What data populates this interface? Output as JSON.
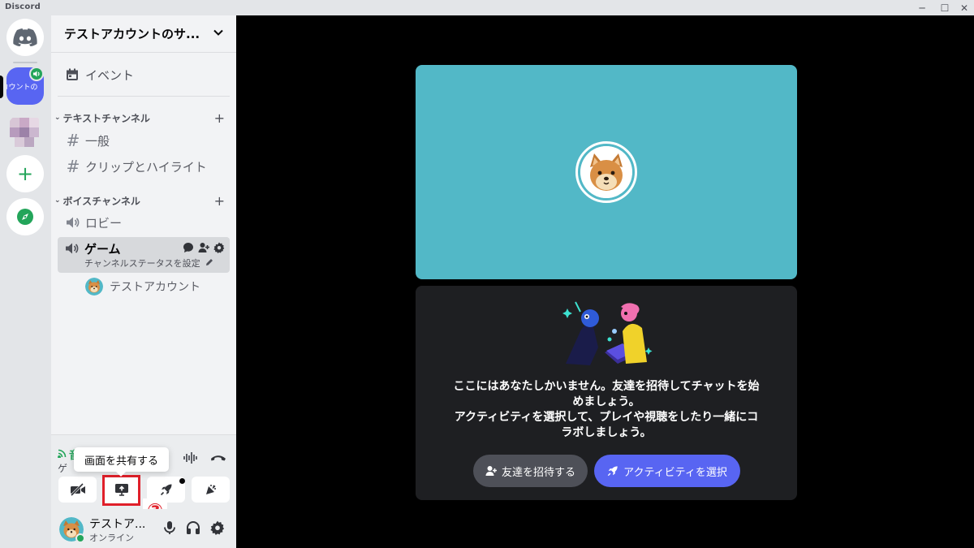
{
  "window": {
    "title": "Discord",
    "controls": {
      "minimize": "─",
      "maximize": "☐",
      "close": "✕"
    }
  },
  "rail": {
    "active_server_label": "カウントの",
    "add_glyph": "+"
  },
  "sidebar": {
    "server_name": "テストアカウントのサ...",
    "events_label": "イベント",
    "text_category": "テキストチャンネル",
    "text_channels": [
      "一般",
      "クリップとハイライト"
    ],
    "voice_category": "ボイスチャンネル",
    "voice_channels": [
      "ロビー"
    ],
    "active_voice_channel": {
      "name": "ゲーム",
      "status_prompt": "チャンネルステータスを設定"
    },
    "member_in_channel": "テストアカウント",
    "hash_glyph": "#",
    "plus_glyph": "+",
    "caret_glyph": "⌄"
  },
  "voice_panel": {
    "connection_status": "音声",
    "channel_text": "ゲ"
  },
  "tooltip": {
    "text": "画面を共有する"
  },
  "annotation": {
    "step_number": "③"
  },
  "user_panel": {
    "name": "テストア...",
    "status": "オンライン"
  },
  "main": {
    "invite_message_lines": [
      "ここにはあなたしかいません。友達を招待してチャットを始",
      "めましょう。",
      "アクティビティを選択して、プレイや視聴をしたり一緒にコ",
      "ラボしましょう。"
    ],
    "invite_button": "友達を招待する",
    "activity_button": "アクティビティを選択"
  },
  "colors": {
    "blurple": "#5865f2",
    "green": "#23a55a",
    "video_tile": "#52b8c7",
    "card": "#1e1f22",
    "highlight_red": "#e0202a"
  }
}
